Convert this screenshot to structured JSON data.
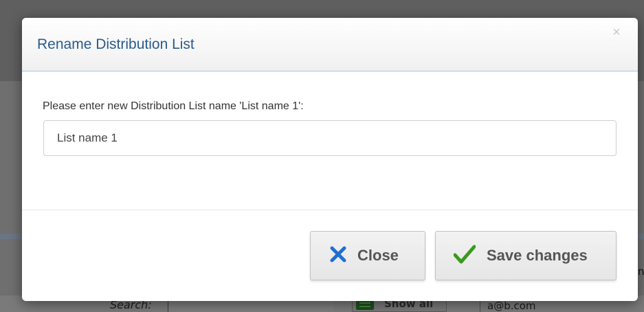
{
  "background": {
    "search_label": "Search:",
    "show_all_label": "Show all",
    "email": "a@b.com",
    "edge_char": "n"
  },
  "modal": {
    "title": "Rename Distribution List",
    "close_glyph": "×",
    "prompt": "Please enter new Distribution List name 'List name 1':",
    "input_value": "List name 1",
    "close_button_label": "Close",
    "save_button_label": "Save changes"
  },
  "icons": {
    "close_button_icon": "x-icon",
    "save_button_icon": "checkmark-icon",
    "dismiss_icon": "close-icon",
    "list_icon": "list-icon"
  },
  "colors": {
    "title": "#2a5b8c",
    "x_icon": "#1f6fd1",
    "check_icon": "#3a9a1e",
    "header_border": "#9ccbe4"
  }
}
